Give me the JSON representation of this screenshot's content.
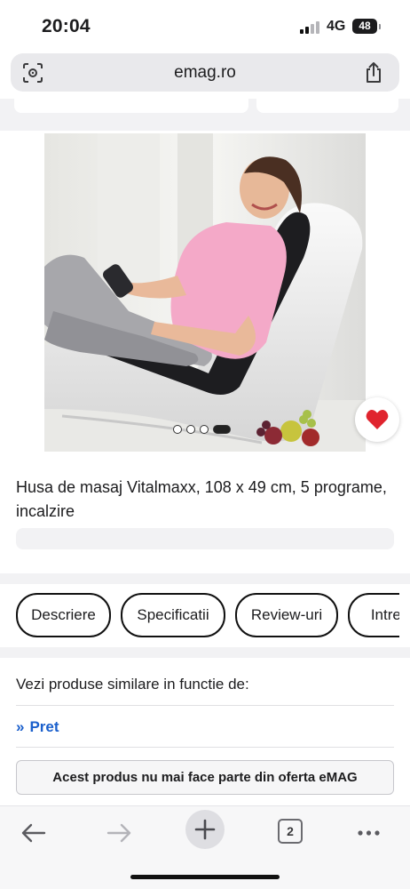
{
  "status_bar": {
    "time": "20:04",
    "network": "4G",
    "battery": "48"
  },
  "browser": {
    "address": "emag.ro"
  },
  "product": {
    "title": "Husa de masaj Vitalmaxx, 108 x 49 cm, 5 programe, incalzire",
    "image_alt": "Femeie zambind intinsa pe husa de masaj pe un sezlong alb",
    "carousel_count": 4,
    "carousel_active": 4
  },
  "tabs": [
    {
      "label": "Descriere"
    },
    {
      "label": "Specificatii"
    },
    {
      "label": "Review-uri"
    },
    {
      "label": "Intrebari"
    }
  ],
  "similar": {
    "heading": "Vezi produse similare in functie de:",
    "links": [
      {
        "chevron": "»",
        "label": "Pret"
      }
    ]
  },
  "notice": {
    "label": "Acest produs nu mai face parte din oferta eMAG"
  },
  "toolbar": {
    "tabs_count": "2"
  },
  "colors": {
    "accent_link": "#1a5fcc",
    "favorite_heart": "#e0242e",
    "page_band": "#f2f2f4"
  },
  "icons": [
    "page-settings-icon",
    "share-icon",
    "heart-icon",
    "back-arrow-icon",
    "forward-arrow-icon",
    "plus-icon",
    "tabs-icon",
    "more-icon"
  ]
}
